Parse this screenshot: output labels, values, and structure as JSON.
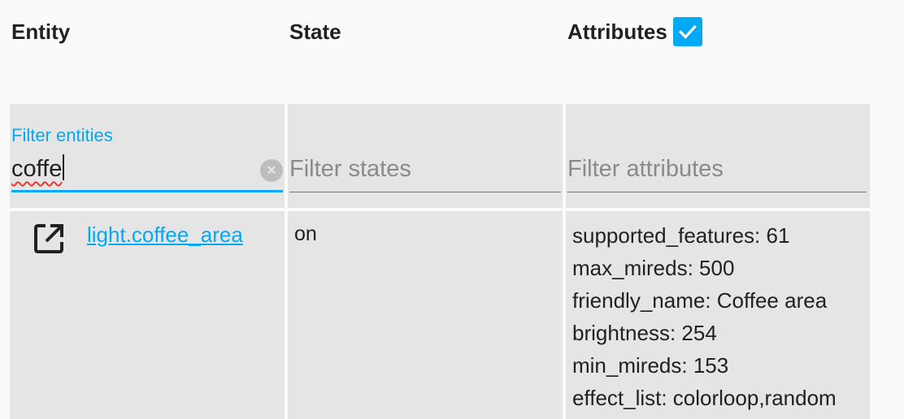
{
  "headers": {
    "entity": "Entity",
    "state": "State",
    "attributes": "Attributes",
    "attributes_checked": true
  },
  "filters": {
    "entity": {
      "label": "Filter entities",
      "value": "coffe"
    },
    "state": {
      "placeholder": "Filter states",
      "value": ""
    },
    "attributes": {
      "placeholder": "Filter attributes",
      "value": ""
    }
  },
  "rows": [
    {
      "entity_id": "light.coffee_area",
      "state": "on",
      "attributes": [
        "supported_features: 61",
        "max_mireds: 500",
        "friendly_name: Coffee area",
        "brightness: 254",
        "min_mireds: 153",
        "effect_list: colorloop,random"
      ]
    }
  ],
  "icons": {
    "open_entity": "open-in-new-icon",
    "clear": "clear-icon",
    "checkbox": "check-icon"
  },
  "colors": {
    "accent": "#03a9f4",
    "cell_bg": "#e5e5e5",
    "spellcheck": "#e53935"
  }
}
